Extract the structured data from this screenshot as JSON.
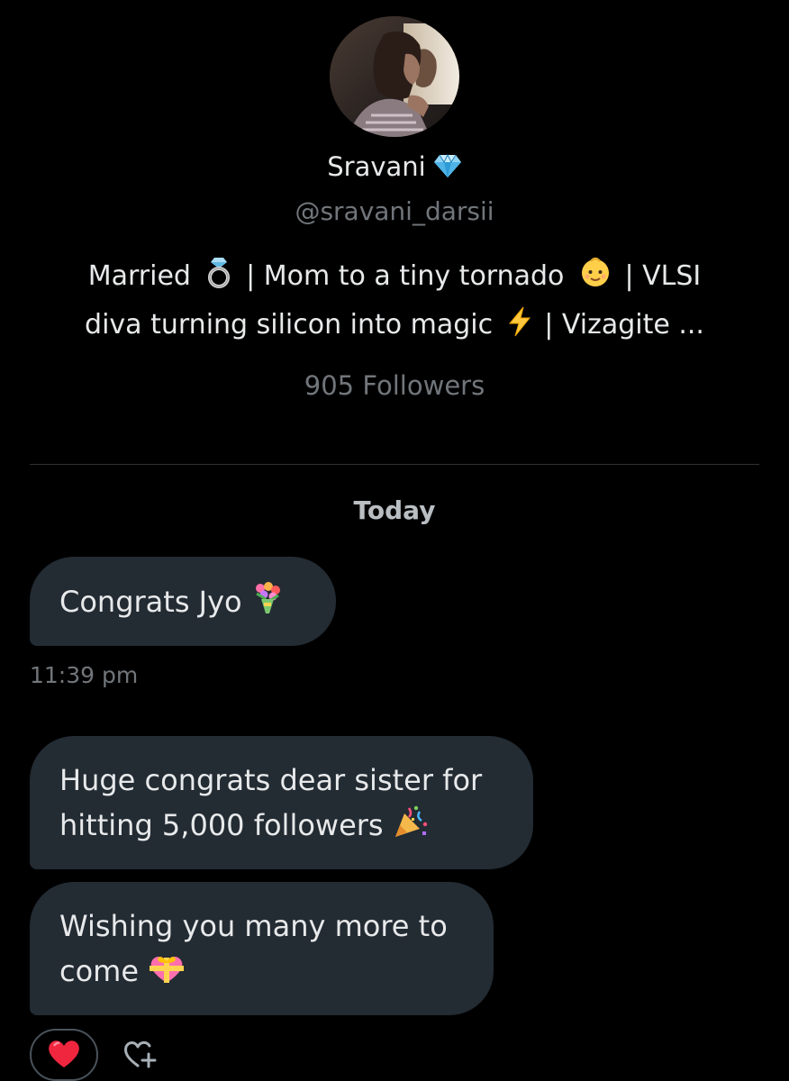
{
  "profile": {
    "display_name": "Sravani",
    "name_badge_icon": "gem-icon",
    "handle": "@sravani_darsii",
    "bio_line_1_a": "Married",
    "bio_line_1_b": "| Mom to a tiny tornado",
    "bio_line_1_c": "| VLSI",
    "bio_line_2_a": "diva turning silicon into magic",
    "bio_line_2_b": "| Vizagite ...",
    "followers_text": "905 Followers"
  },
  "conversation": {
    "day_label": "Today",
    "messages": [
      {
        "lines": [
          "Congrats Jyo"
        ],
        "emoji_icon": "bouquet-icon"
      },
      {
        "lines": [
          "Huge congrats dear sister for",
          "hitting 5,000 followers"
        ],
        "emoji_icon": "party-popper-icon"
      },
      {
        "lines": [
          "Wishing you many more to",
          "come"
        ],
        "emoji_icon": "heart-with-ribbon-icon"
      }
    ],
    "timestamp": "11:39 pm",
    "reaction": {
      "emoji_icon": "red-heart-icon",
      "add_icon": "add-reaction-icon"
    }
  },
  "colors": {
    "background": "#000000",
    "bubble": "#232b33",
    "primary_text": "#e7e9ea",
    "secondary_text": "#71767b",
    "divider": "#2f3336"
  }
}
